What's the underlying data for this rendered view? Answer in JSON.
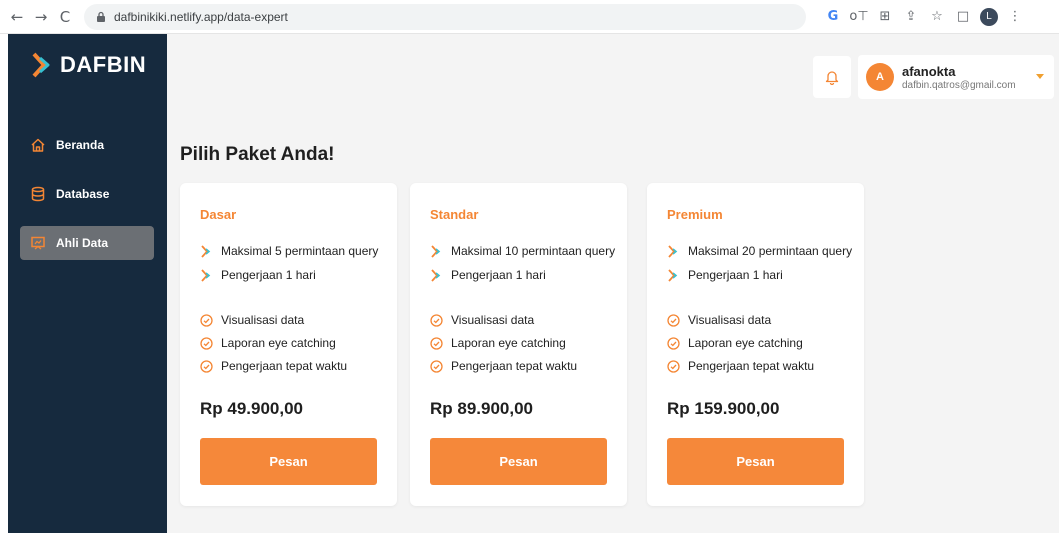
{
  "browser": {
    "back_icon": "←",
    "forward_icon": "→",
    "reload_icon": "C",
    "url": "dafbinikiki.netlify.app/data-expert",
    "google_icon": "G",
    "key_icon": "o⊤",
    "translate_icon": "⊞",
    "share_icon": "⇪",
    "star_icon": "☆",
    "sidepanel_icon": "□",
    "profile_initial": "L",
    "menu_icon": "⋮"
  },
  "sidebar": {
    "logo_text": "DAFBIN",
    "items": [
      {
        "label": "Beranda",
        "icon": "home-icon",
        "active": false
      },
      {
        "label": "Database",
        "icon": "database-icon",
        "active": false
      },
      {
        "label": "Ahli Data",
        "icon": "presentation-icon",
        "active": true
      }
    ]
  },
  "header": {
    "user": {
      "initial": "A",
      "name": "afanokta",
      "email": "dafbin.qatros@gmail.com"
    }
  },
  "main": {
    "title": "Pilih Paket Anda!",
    "plans": [
      {
        "name": "Dasar",
        "query_feature": "Maksimal 5 permintaan query",
        "duration_feature": "Pengerjaan 1 hari",
        "benefits": [
          "Visualisasi data",
          "Laporan eye catching",
          "Pengerjaan tepat waktu"
        ],
        "price": "Rp 49.900,00",
        "button_label": "Pesan"
      },
      {
        "name": "Standar",
        "query_feature": "Maksimal 10 permintaan query",
        "duration_feature": "Pengerjaan 1 hari",
        "benefits": [
          "Visualisasi data",
          "Laporan eye catching",
          "Pengerjaan tepat waktu"
        ],
        "price": "Rp 89.900,00",
        "button_label": "Pesan"
      },
      {
        "name": "Premium",
        "query_feature": "Maksimal 20 permintaan query",
        "duration_feature": "Pengerjaan 1 hari",
        "benefits": [
          "Visualisasi data",
          "Laporan eye catching",
          "Pengerjaan tepat waktu"
        ],
        "price": "Rp 159.900,00",
        "button_label": "Pesan"
      }
    ]
  },
  "colors": {
    "sidebar_bg": "#162a3e",
    "accent_orange": "#f48634",
    "active_item_bg": "#6b6f74",
    "page_bg": "#f4f4f4"
  }
}
